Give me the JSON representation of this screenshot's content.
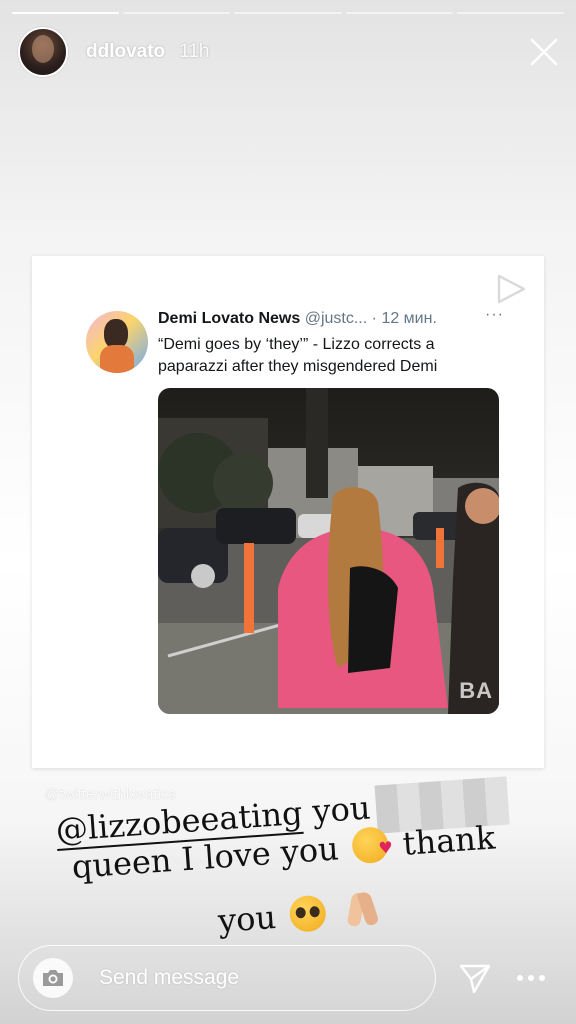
{
  "story": {
    "progress": [
      1.0,
      0,
      0,
      0,
      0
    ],
    "username": "ddlovato",
    "time": "11h"
  },
  "shared_post": {
    "author_name": "Demi Lovato News",
    "author_handle": "@justc...",
    "separator": "·",
    "post_time": "12 мин.",
    "more": "···",
    "text": "“Demi goes by ‘they’” - Lizzo corrects a paparazzi after they misgendered Demi",
    "media_watermark": "BA"
  },
  "source_tag": "@twitterwithlovatics",
  "caption": {
    "mention": "@lizzobeeating",
    "line1_rest": " you",
    "line2_a": "queen I love you",
    "line2_b": "thank",
    "line3": "you"
  },
  "reply": {
    "placeholder": "Send message"
  },
  "icons": {
    "close": "close-icon",
    "share": "share-arrow-icon",
    "camera": "camera-icon",
    "send": "paper-plane-icon",
    "more": "more-dots-icon"
  },
  "colors": {
    "text_dark": "#14171a",
    "text_meta": "#657786",
    "white": "#ffffff"
  }
}
